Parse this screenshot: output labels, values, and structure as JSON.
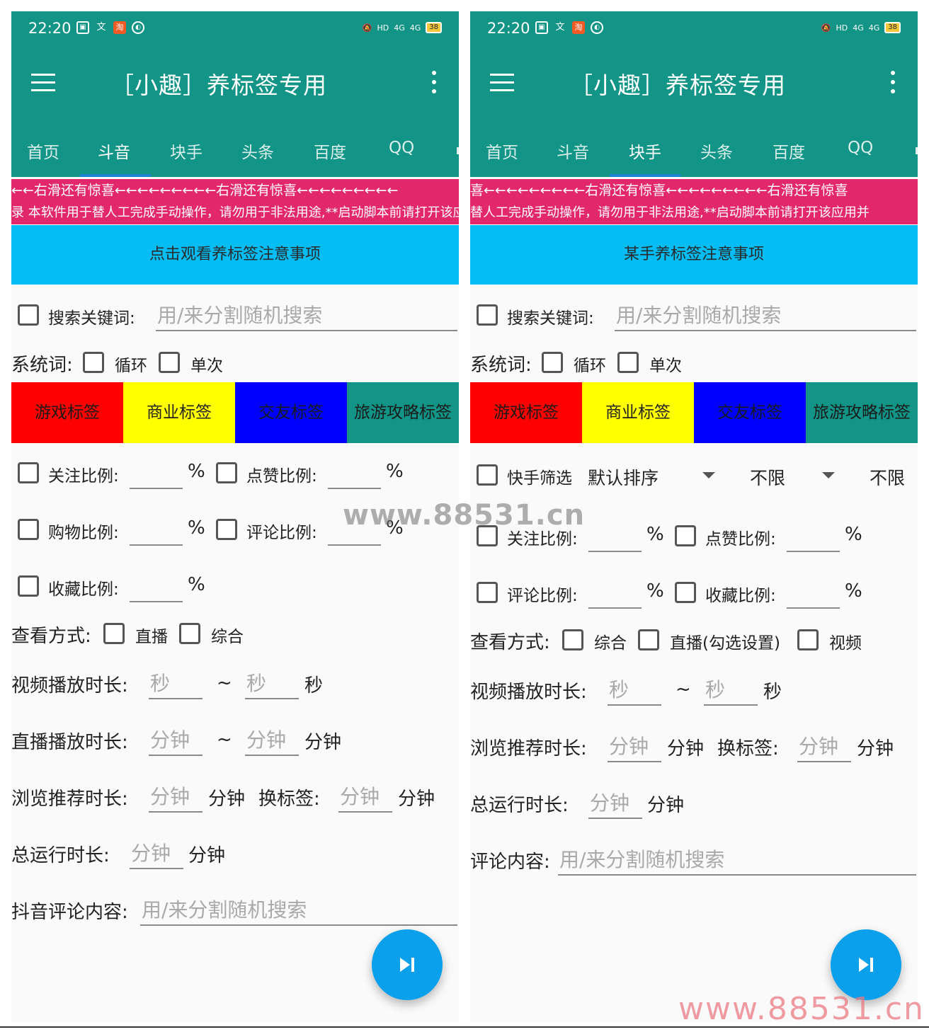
{
  "status": {
    "time": "22:20",
    "left_icons": [
      "message-icon",
      "text-input-icon",
      "taobao-icon",
      "vpn-icon"
    ],
    "right_icons": [
      "alarm-off-icon",
      "hd-icon",
      "signal-4g-icon",
      "signal-4g-icon"
    ],
    "hd": "HD",
    "net1": "4G",
    "net2": "4G",
    "battery": "38"
  },
  "app": {
    "title": "［小趣］养标签专用"
  },
  "tabs": [
    "首页",
    "斗音",
    "块手",
    "头条",
    "百度",
    "QQ"
  ],
  "colors": {
    "primary": "#129486",
    "tab_indicator": "#1b82d6",
    "marquee": "#e3276b",
    "notice": "#04bdf5",
    "fab": "#0aa0ec",
    "tag_game": "#ff0000",
    "tag_business": "#ffff00",
    "tag_social": "#0000ff",
    "tag_travel": "#129486"
  },
  "tags": [
    "游戏标签",
    "商业标签",
    "交友标签",
    "旅游攻略标签"
  ],
  "left": {
    "active_tab": "斗音",
    "marquee1": "←←右滑还有惊喜←←←←←←←←←右滑还有惊喜←←←←←←←←←",
    "marquee2": "录 本软件用于替人工完成手动操作，请勿用于非法用途,**启动脚本前请打开该应用",
    "notice": "点击观看养标签注意事项",
    "search_label": "搜索关键词:",
    "search_placeholder": "用/来分割随机搜索",
    "system_label": "系统词:",
    "loop_label": "循环",
    "once_label": "单次",
    "follow_label": "关注比例:",
    "like_label": "点赞比例:",
    "shop_label": "购物比例:",
    "comment_label": "评论比例:",
    "fav_label": "收藏比例:",
    "percent": "%",
    "view_label": "查看方式:",
    "live_label": "直播",
    "mixed_label": "综合",
    "video_dur_label": "视频播放时长:",
    "sec_ph": "秒",
    "tilde": "~",
    "sec_unit": "秒",
    "live_dur_label": "直播播放时长:",
    "min_ph": "分钟",
    "min_unit": "分钟",
    "browse_label": "浏览推荐时长:",
    "switch_label": "换标签:",
    "total_label": "总运行时长:",
    "comment_content_label": "抖音评论内容:",
    "comment_placeholder": "用/来分割随机搜索"
  },
  "right": {
    "active_tab": "块手",
    "marquee1": "喜←←←←←←←←←右滑还有惊喜←←←←←←←←←右滑还有惊喜",
    "marquee2": "替人工完成手动操作，请勿用于非法用途,**启动脚本前请打开该应用并",
    "notice": "某手养标签注意事项",
    "search_label": "搜索关键词:",
    "search_placeholder": "用/来分割随机搜索",
    "system_label": "系统词:",
    "loop_label": "循环",
    "once_label": "单次",
    "filter_label": "快手筛选",
    "sort_value": "默认排序",
    "limit1": "不限",
    "limit2": "不限",
    "follow_label": "关注比例:",
    "like_label": "点赞比例:",
    "comment_label": "评论比例:",
    "fav_label": "收藏比例:",
    "percent": "%",
    "view_label": "查看方式:",
    "mixed_label": "综合",
    "live_setting_label": "直播(勾选设置)",
    "video_label": "视频",
    "video_dur_label": "视频播放时长:",
    "sec_ph": "秒",
    "tilde": "~",
    "sec_unit": "秒",
    "browse_label": "浏览推荐时长:",
    "min_ph": "分钟",
    "min_unit": "分钟",
    "switch_label": "换标签:",
    "total_label": "总运行时长:",
    "comment_content_label": "评论内容:",
    "comment_placeholder": "用/来分割随机搜索"
  },
  "watermarks": [
    "www.88531.cn",
    "www.88531.cn"
  ]
}
